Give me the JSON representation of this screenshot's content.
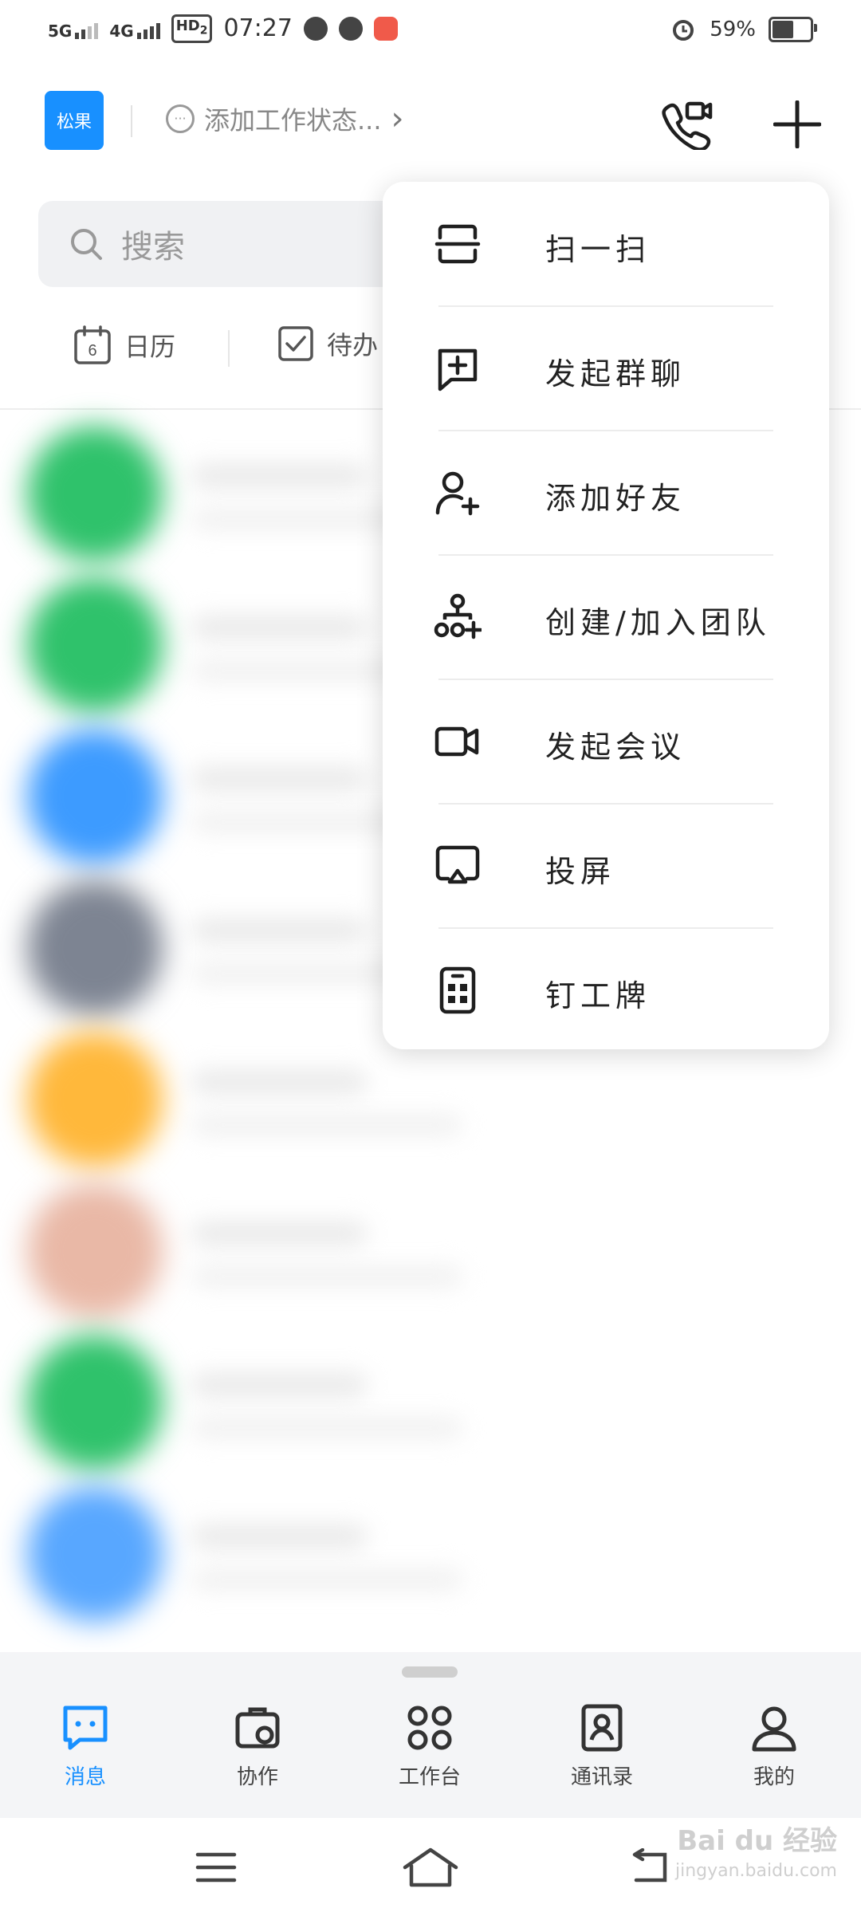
{
  "status_bar": {
    "net1": "5G",
    "net2": "4G",
    "hd": "HD",
    "hd_sub": "2",
    "time": "07:27",
    "battery": "59%",
    "battery_level": 0.59
  },
  "header": {
    "avatar_text": "松果",
    "status_text": "添加工作状态...",
    "chevron": "›"
  },
  "search": {
    "placeholder": "搜索"
  },
  "quick": {
    "calendar_day": "6",
    "calendar_label": "日历",
    "todo_label": "待办"
  },
  "chat_rows": [
    {
      "color": "#2fc26b"
    },
    {
      "color": "#2fc26b"
    },
    {
      "color": "#3d9bff"
    },
    {
      "color": "#7d8492"
    },
    {
      "color": "#ffb83b"
    },
    {
      "color": "#e9b8a6"
    },
    {
      "color": "#2fc26b"
    },
    {
      "color": "#58a7ff"
    }
  ],
  "popup_menu": {
    "items": [
      {
        "label": "扫一扫",
        "icon": "scan-icon"
      },
      {
        "label": "发起群聊",
        "icon": "group-chat-icon"
      },
      {
        "label": "添加好友",
        "icon": "add-friend-icon"
      },
      {
        "label": "创建/加入团队",
        "icon": "team-icon"
      },
      {
        "label": "发起会议",
        "icon": "video-icon"
      },
      {
        "label": "投屏",
        "icon": "screencast-icon"
      },
      {
        "label": "钉工牌",
        "icon": "badge-icon"
      }
    ]
  },
  "bottom_nav": {
    "active": "消息",
    "active_color": "#1890ff",
    "items": [
      {
        "label": "消息",
        "icon": "message-icon"
      },
      {
        "label": "协作",
        "icon": "collab-icon"
      },
      {
        "label": "工作台",
        "icon": "workbench-icon"
      },
      {
        "label": "通讯录",
        "icon": "contacts-icon"
      },
      {
        "label": "我的",
        "icon": "profile-icon"
      }
    ]
  },
  "watermark": {
    "brand": "Bai du 经验",
    "url": "jingyan.baidu.com"
  }
}
